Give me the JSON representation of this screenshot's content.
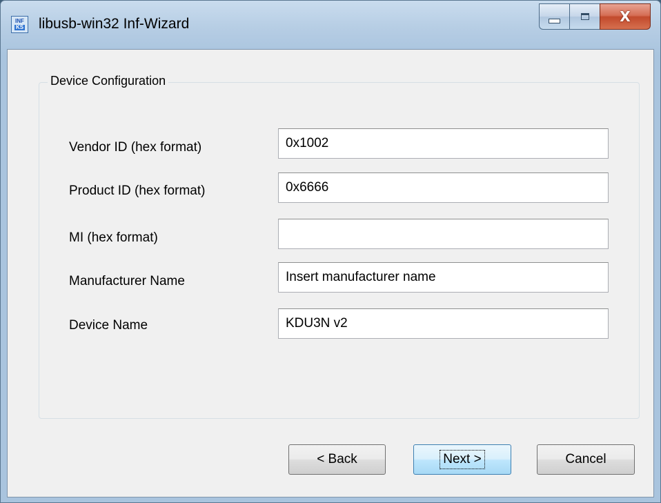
{
  "window": {
    "title": "libusb-win32 Inf-Wizard",
    "icon": {
      "name": "inf-wizard-app-icon",
      "top_text": "INF",
      "bottom_text": "KS"
    }
  },
  "caption_buttons": {
    "minimize_icon": "minimize-icon",
    "maximize_icon": "maximize-icon",
    "close_label": "X"
  },
  "group": {
    "title": "Device Configuration"
  },
  "fields": [
    {
      "label": "Vendor ID (hex format)",
      "value": "0x1002",
      "placeholder": ""
    },
    {
      "label": "Product ID (hex format)",
      "value": "0x6666",
      "placeholder": ""
    },
    {
      "label": "MI (hex format)",
      "value": "",
      "placeholder": ""
    },
    {
      "label": "Manufacturer Name",
      "value": "Insert manufacturer name",
      "placeholder": ""
    },
    {
      "label": "Device Name",
      "value": "KDU3N v2",
      "placeholder": ""
    }
  ],
  "buttons": {
    "back": "< Back",
    "next": "Next >",
    "cancel": "Cancel"
  },
  "colors": {
    "title_bar": "#b6cde4",
    "close_button": "#c24a2d",
    "default_button_border": "#3c7fb1",
    "dialog_background": "#f0f0f0"
  }
}
